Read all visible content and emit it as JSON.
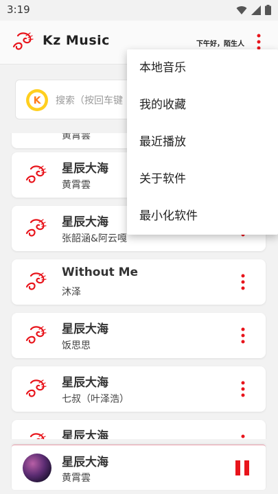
{
  "status_bar": {
    "time": "3:19"
  },
  "app_bar": {
    "title": "Kz Music",
    "greeting": "下午好，陌生人"
  },
  "search": {
    "placeholder": "搜索（按回车键"
  },
  "songs": [
    {
      "title": "星辰大海",
      "artist": "黄霄雲"
    },
    {
      "title": "星辰大海",
      "artist": "张韶涵&阿云嘎"
    },
    {
      "title": "Without Me",
      "artist": "沐泽"
    },
    {
      "title": "星辰大海",
      "artist": "饭思思"
    },
    {
      "title": "星辰大海",
      "artist": "七叔（叶泽浩）"
    },
    {
      "title": "星辰大海",
      "artist": ""
    }
  ],
  "partial_top_artist": "黄霄雲",
  "now_playing": {
    "title": "星辰大海",
    "artist": "黄霄雲"
  },
  "menu": {
    "items": [
      "本地音乐",
      "我的收藏",
      "最近播放",
      "关于软件",
      "最小化软件"
    ]
  },
  "colors": {
    "accent": "#e8141b",
    "background": "#f2f2f2"
  },
  "icons": {
    "logo": "music-swirl-icon",
    "song": "music-swirl-icon",
    "search": "kuwo-search-icon",
    "more": "vertical-dots-icon",
    "pause": "pause-icon"
  }
}
